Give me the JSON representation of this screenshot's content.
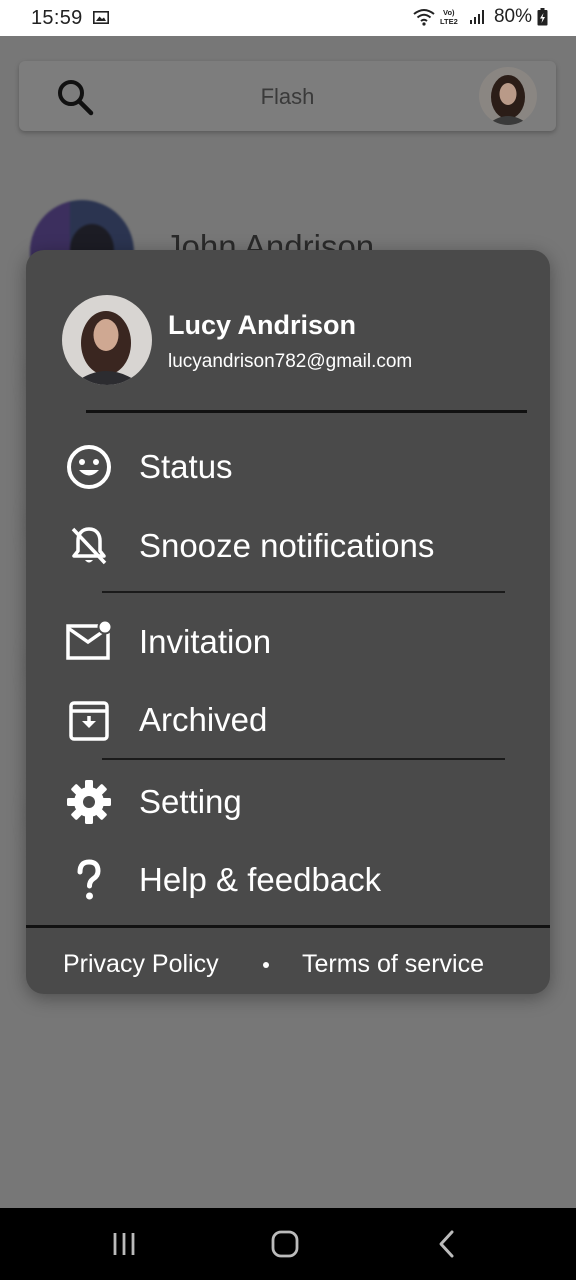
{
  "status_bar": {
    "time": "15:59",
    "network_label": "Vo) LTE2",
    "battery": "80%"
  },
  "search": {
    "placeholder": "Flash"
  },
  "chat_list": {
    "first_contact_name": "John Andrison"
  },
  "account_menu": {
    "user_name": "Lucy Andrison",
    "user_email": "lucyandrison782@gmail.com",
    "items": [
      {
        "label": "Status",
        "icon": "smiley-icon"
      },
      {
        "label": "Snooze notifications",
        "icon": "notifications-off-icon"
      },
      {
        "label": "Invitation",
        "icon": "mail-unread-icon"
      },
      {
        "label": "Archived",
        "icon": "archive-icon"
      },
      {
        "label": "Setting",
        "icon": "gear-icon"
      },
      {
        "label": "Help & feedback",
        "icon": "question-icon"
      }
    ],
    "footer": {
      "privacy_label": "Privacy Policy",
      "terms_label": "Terms of service"
    }
  },
  "colors": {
    "card_background": "#4a4a4a",
    "overlay": "#777777",
    "text": "#ffffff"
  }
}
